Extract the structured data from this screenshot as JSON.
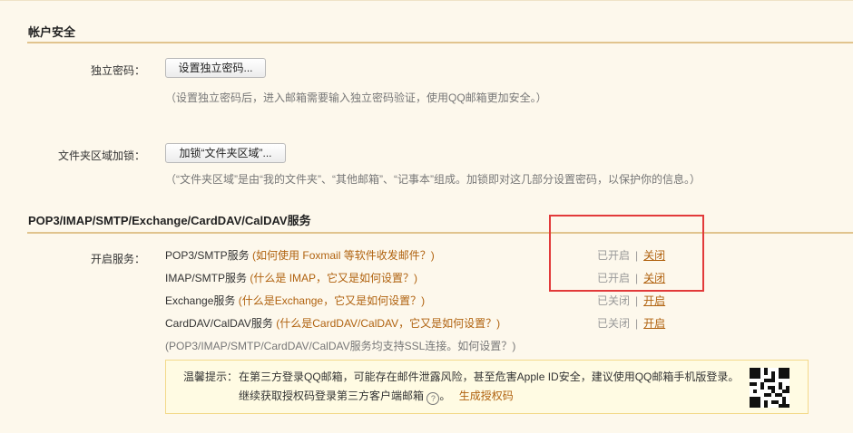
{
  "account_security": {
    "title": "帐户安全",
    "independent_password": {
      "label": "独立密码：",
      "button": "设置独立密码...",
      "hint": "（设置独立密码后，进入邮箱需要输入独立密码验证，使用QQ邮箱更加安全。）"
    },
    "folder_lock": {
      "label": "文件夹区域加锁：",
      "button": "加锁“文件夹区域”...",
      "hint": "（“文件夹区域”是由“我的文件夹”、“其他邮箱”、“记事本”组成。加锁即对这几部分设置密码，以保护你的信息。）"
    }
  },
  "protocols": {
    "title": "POP3/IMAP/SMTP/Exchange/CardDAV/CalDAV服务",
    "label": "开启服务：",
    "services": [
      {
        "name": "POP3/SMTP服务",
        "help": "(如何使用 Foxmail 等软件收发邮件？)",
        "status": "已开启",
        "sep": "|",
        "action": "关闭"
      },
      {
        "name": "IMAP/SMTP服务",
        "help": "(什么是 IMAP，它又是如何设置？)",
        "status": "已开启",
        "sep": "|",
        "action": "关闭"
      },
      {
        "name": "Exchange服务",
        "help": "(什么是Exchange，它又是如何设置？)",
        "status": "已关闭",
        "sep": "|",
        "action": "开启"
      },
      {
        "name": "CardDAV/CalDAV服务",
        "help": "(什么是CardDAV/CalDAV，它又是如何设置？)",
        "status": "已关闭",
        "sep": "|",
        "action": "开启"
      }
    ],
    "ssl_note_prefix": "(POP3/IMAP/SMTP/CardDAV/CalDAV服务均支持SSL连接。",
    "ssl_note_link": "如何设置？",
    "ssl_note_suffix": ")"
  },
  "tip": {
    "prefix": "温馨提示：",
    "line1": "在第三方登录QQ邮箱，可能存在邮件泄露风险，甚至危害Apple ID安全，建议使用QQ邮箱手机版登录。",
    "line2": "继续获取授权码登录第三方客户端邮箱",
    "help_icon": "?",
    "line2_mid": "。",
    "generate_link": "生成授权码"
  },
  "colors": {
    "accent_link": "#b0620f",
    "divider": "#e1c48e",
    "highlight_box": "#e23a3a",
    "background": "#fdf8ec"
  }
}
